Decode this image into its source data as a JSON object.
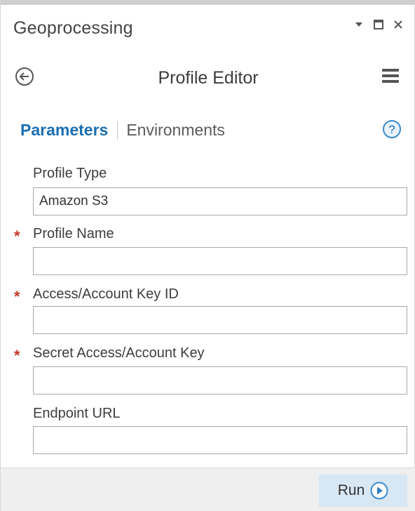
{
  "pane": {
    "title": "Geoprocessing"
  },
  "tool": {
    "title": "Profile Editor"
  },
  "tabs": {
    "active": "Parameters",
    "other": "Environments"
  },
  "params": [
    {
      "label": "Profile Type",
      "value": "Amazon S3",
      "required": false
    },
    {
      "label": "Profile Name",
      "value": "",
      "required": true
    },
    {
      "label": "Access/Account Key ID",
      "value": "",
      "required": true
    },
    {
      "label": "Secret Access/Account Key",
      "value": "",
      "required": true
    },
    {
      "label": "Endpoint URL",
      "value": "",
      "required": false
    }
  ],
  "footer": {
    "run_label": "Run"
  },
  "icons": {
    "back": "back-arrow-icon",
    "menu": "hamburger-menu-icon",
    "help": "help-icon",
    "run": "play-icon"
  },
  "colors": {
    "accent": "#1b6fb3",
    "required": "#c4392b",
    "run_button_bg": "#d8e7f4"
  }
}
